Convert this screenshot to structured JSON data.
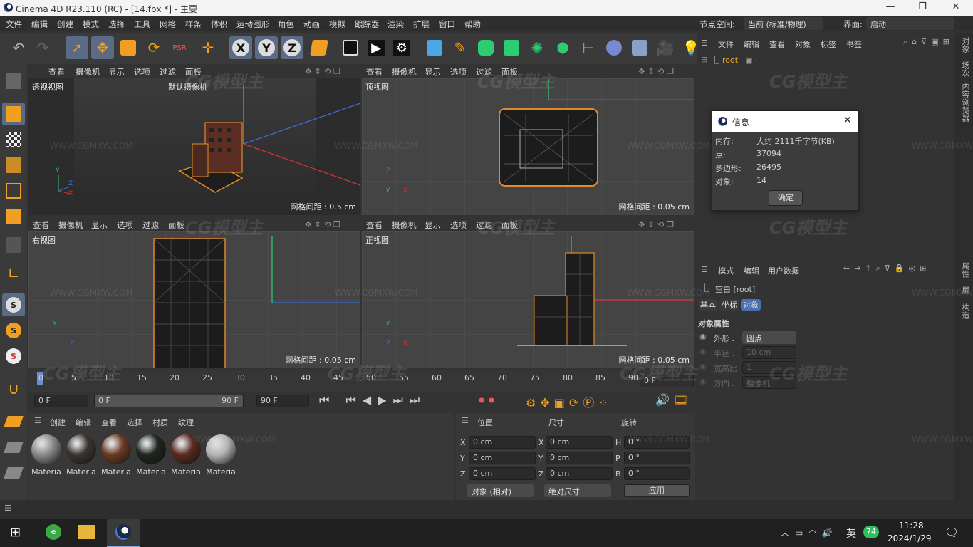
{
  "window": {
    "title": "Cinema 4D R23.110 (RC) - [14.fbx *] - 主要"
  },
  "menu": [
    "文件",
    "编辑",
    "创建",
    "模式",
    "选择",
    "工具",
    "网格",
    "样条",
    "体积",
    "运动图形",
    "角色",
    "动画",
    "模拟",
    "跟踪器",
    "渲染",
    "扩展",
    "窗口",
    "帮助"
  ],
  "menu_right": {
    "node_space_label": "节点空间:",
    "node_space_value": "当前 (标准/物理)",
    "layout_label": "界面:",
    "layout_value": "启动"
  },
  "viewport_menu": [
    "查看",
    "摄像机",
    "显示",
    "选项",
    "过滤",
    "面板"
  ],
  "viewports": [
    {
      "name": "透视视图",
      "camera": "默认摄像机",
      "grid": "网格间距 : 0.5 cm"
    },
    {
      "name": "顶视图",
      "grid": "网格间距 : 0.05 cm"
    },
    {
      "name": "右视图",
      "grid": "网格间距 : 0.05 cm"
    },
    {
      "name": "正视图",
      "grid": "网格间距 : 0.05 cm"
    }
  ],
  "timeline": {
    "ticks": [
      "0",
      "5",
      "10",
      "15",
      "20",
      "25",
      "30",
      "35",
      "40",
      "45",
      "50",
      "55",
      "60",
      "65",
      "70",
      "75",
      "80",
      "85",
      "90"
    ],
    "current_frame": "0 F"
  },
  "time_controls": {
    "start": "0 F",
    "range_start": "0 F",
    "range_end": "90 F",
    "end": "90 F"
  },
  "material_menu": [
    "创建",
    "编辑",
    "查看",
    "选择",
    "材质",
    "纹理"
  ],
  "materials": [
    {
      "label": "Materia",
      "color": "#8a8a8a"
    },
    {
      "label": "Materia",
      "color": "#3b3530"
    },
    {
      "label": "Materia",
      "color": "#6b3a25"
    },
    {
      "label": "Materia",
      "color": "#1f2520"
    },
    {
      "label": "Materia",
      "color": "#5a2a22"
    },
    {
      "label": "Materia",
      "color": "#b5b5b5"
    }
  ],
  "coords": {
    "headers": [
      "位置",
      "尺寸",
      "旋转"
    ],
    "rows": [
      {
        "a": "X",
        "pos": "0 cm",
        "b": "X",
        "size": "0 cm",
        "c": "H",
        "rot": "0 °"
      },
      {
        "a": "Y",
        "pos": "0 cm",
        "b": "Y",
        "size": "0 cm",
        "c": "P",
        "rot": "0 °"
      },
      {
        "a": "Z",
        "pos": "0 cm",
        "b": "Z",
        "size": "0 cm",
        "c": "B",
        "rot": "0 °"
      }
    ],
    "mode": "对象 (相对)",
    "size_mode": "绝对尺寸",
    "apply": "应用"
  },
  "object_manager": {
    "menu": [
      "文件",
      "编辑",
      "查看",
      "对象",
      "标签",
      "书签"
    ],
    "root": "root"
  },
  "info_dialog": {
    "title": "信息",
    "rows": [
      {
        "k": "内存:",
        "v": "大约 2111千字节(KB)"
      },
      {
        "k": "点:",
        "v": "37094"
      },
      {
        "k": "多边形:",
        "v": "26495"
      },
      {
        "k": "对象:",
        "v": "14"
      }
    ],
    "ok": "确定"
  },
  "attributes": {
    "menu": [
      "模式",
      "编辑",
      "用户数据"
    ],
    "object": "空白 [root]",
    "tabs": [
      "基本",
      "坐标",
      "对象"
    ],
    "section": "对象属性",
    "props": [
      {
        "label": "外形 .",
        "value": "圆点"
      },
      {
        "label": "半径 .",
        "value": "10 cm"
      },
      {
        "label": "宽高比",
        "value": "1"
      },
      {
        "label": "方向 .",
        "value": "摄像机"
      }
    ]
  },
  "side_tabs": [
    "对象",
    "场次",
    "内容浏览器",
    "属性",
    "层",
    "构造"
  ],
  "watermark": {
    "brand": "CG模型主",
    "url": "WWW.CGMXW.COM"
  },
  "taskbar": {
    "lang": "英",
    "badge": "74",
    "time": "11:28",
    "date": "2024/1/29"
  }
}
